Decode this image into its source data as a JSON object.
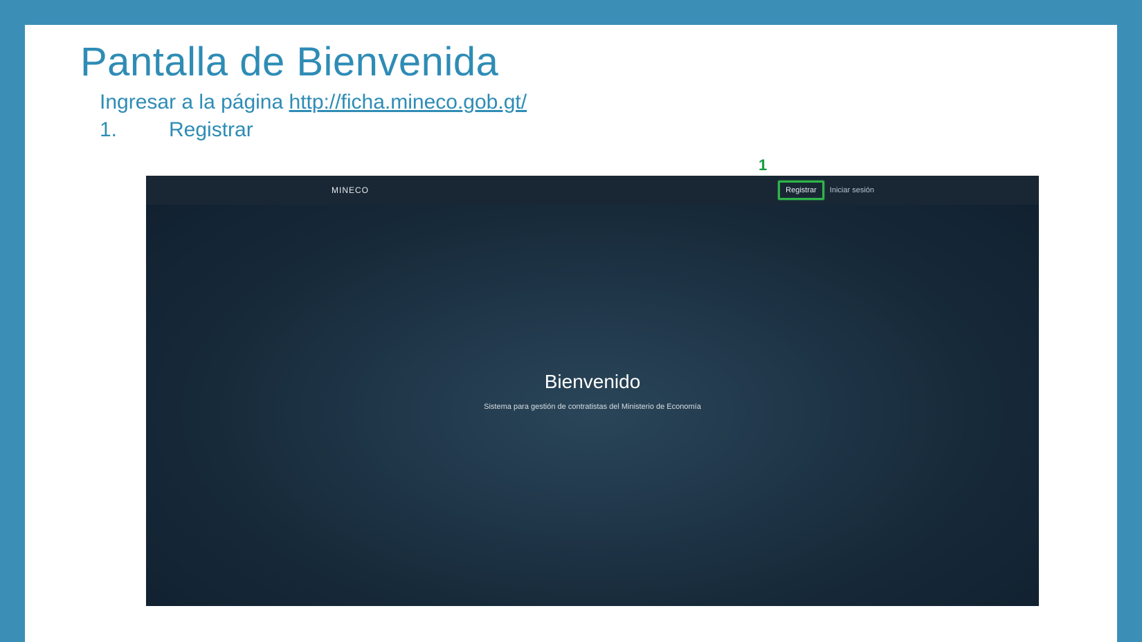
{
  "slide": {
    "title": "Pantalla de Bienvenida",
    "instruction_prefix": "Ingresar a la página ",
    "instruction_link": "http://ficha.mineco.gob.gt/",
    "step_number": "1.",
    "step_label": "Registrar",
    "callout": "1"
  },
  "app": {
    "brand": "MINECO",
    "nav": {
      "register": "Registrar",
      "login": "Iniciar sesión"
    },
    "hero": {
      "title": "Bienvenido",
      "subtitle": "Sistema para gestión de contratistas del Ministerio de Economía"
    }
  }
}
